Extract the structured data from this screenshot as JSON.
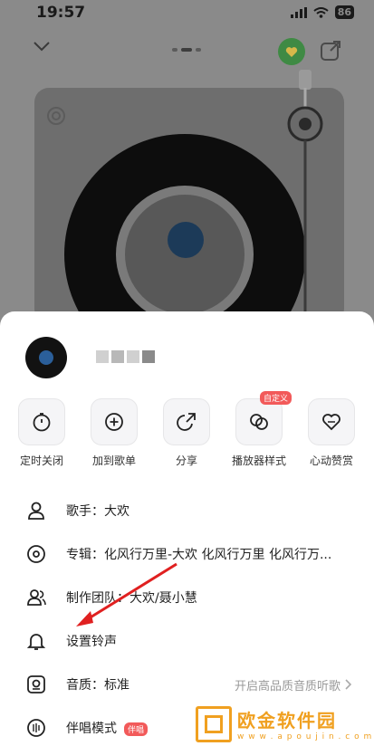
{
  "status_bar": {
    "time": "19:57",
    "battery": "86"
  },
  "song": {
    "title_placeholder": ""
  },
  "actions": [
    {
      "icon": "timer-icon",
      "label": "定时关闭"
    },
    {
      "icon": "add-to-playlist-icon",
      "label": "加到歌单"
    },
    {
      "icon": "share-icon",
      "label": "分享"
    },
    {
      "icon": "player-style-icon",
      "label": "播放器样式",
      "badge": "自定义"
    },
    {
      "icon": "heart-tip-icon",
      "label": "心动赞赏"
    }
  ],
  "info_rows": [
    {
      "icon": "singer-icon",
      "text": "歌手：大欢"
    },
    {
      "icon": "album-icon",
      "text": "专辑：化风行万里-大欢 化风行万里 化风行万..."
    },
    {
      "icon": "team-icon",
      "text": "制作团队：大欢/聂小慧"
    },
    {
      "icon": "bell-icon",
      "text": "设置铃声"
    },
    {
      "icon": "quality-icon",
      "text": "音质：标准",
      "right": "开启高品质音质听歌"
    },
    {
      "icon": "karaoke-icon",
      "text": "伴唱模式",
      "badge": "伴唱"
    }
  ],
  "watermark": {
    "name": "欧金软件园",
    "url": "w w w . a p o u j i n . c o m"
  }
}
